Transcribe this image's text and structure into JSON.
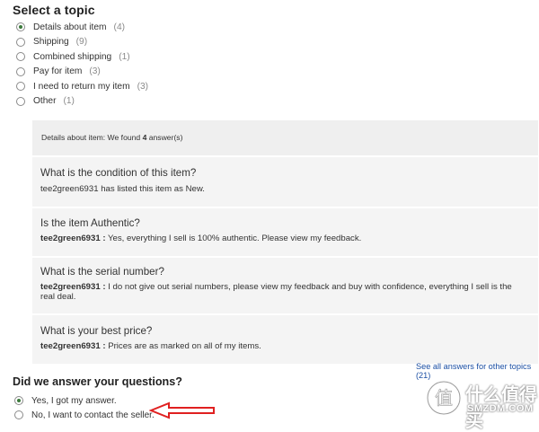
{
  "topics_section": {
    "title": "Select a topic",
    "items": [
      {
        "label": "Details about item",
        "count": "(4)",
        "selected": true
      },
      {
        "label": "Shipping",
        "count": "(9)",
        "selected": false
      },
      {
        "label": "Combined shipping",
        "count": "(1)",
        "selected": false
      },
      {
        "label": "Pay for item",
        "count": "(3)",
        "selected": false
      },
      {
        "label": "I need to return my item",
        "count": "(3)",
        "selected": false
      },
      {
        "label": "Other",
        "count": "(1)",
        "selected": false
      }
    ]
  },
  "answers_panel": {
    "header_prefix": "Details about item: We found ",
    "header_count": "4",
    "header_suffix": " answer(s)",
    "qas": [
      {
        "question": "What is the condition of this item?",
        "author": "",
        "answer": "tee2green6931 has listed this item as New."
      },
      {
        "question": "Is the item Authentic?",
        "author": "tee2green6931 :",
        "answer": " Yes, everything I sell is 100% authentic. Please view my feedback."
      },
      {
        "question": "What is the serial number?",
        "author": "tee2green6931 :",
        "answer": " I do not give out serial numbers, please view my feedback and buy with confidence, everything I sell is the real deal."
      },
      {
        "question": "What is your best price?",
        "author": "tee2green6931 :",
        "answer": " Prices are as marked on all of my items."
      }
    ]
  },
  "see_all_link": "See all answers for other topics (21)",
  "feedback_section": {
    "title": "Did we answer your questions?",
    "options": [
      {
        "label": "Yes, I got my answer.",
        "selected": true
      },
      {
        "label": "No, I want to contact the seller.",
        "selected": false
      }
    ]
  },
  "watermark": {
    "line1": "什么值得买",
    "line2": "SMZDM.COM"
  },
  "colors": {
    "link": "#1a4ea3",
    "panel_bg": "#efefef",
    "arrow": "#e02020"
  }
}
